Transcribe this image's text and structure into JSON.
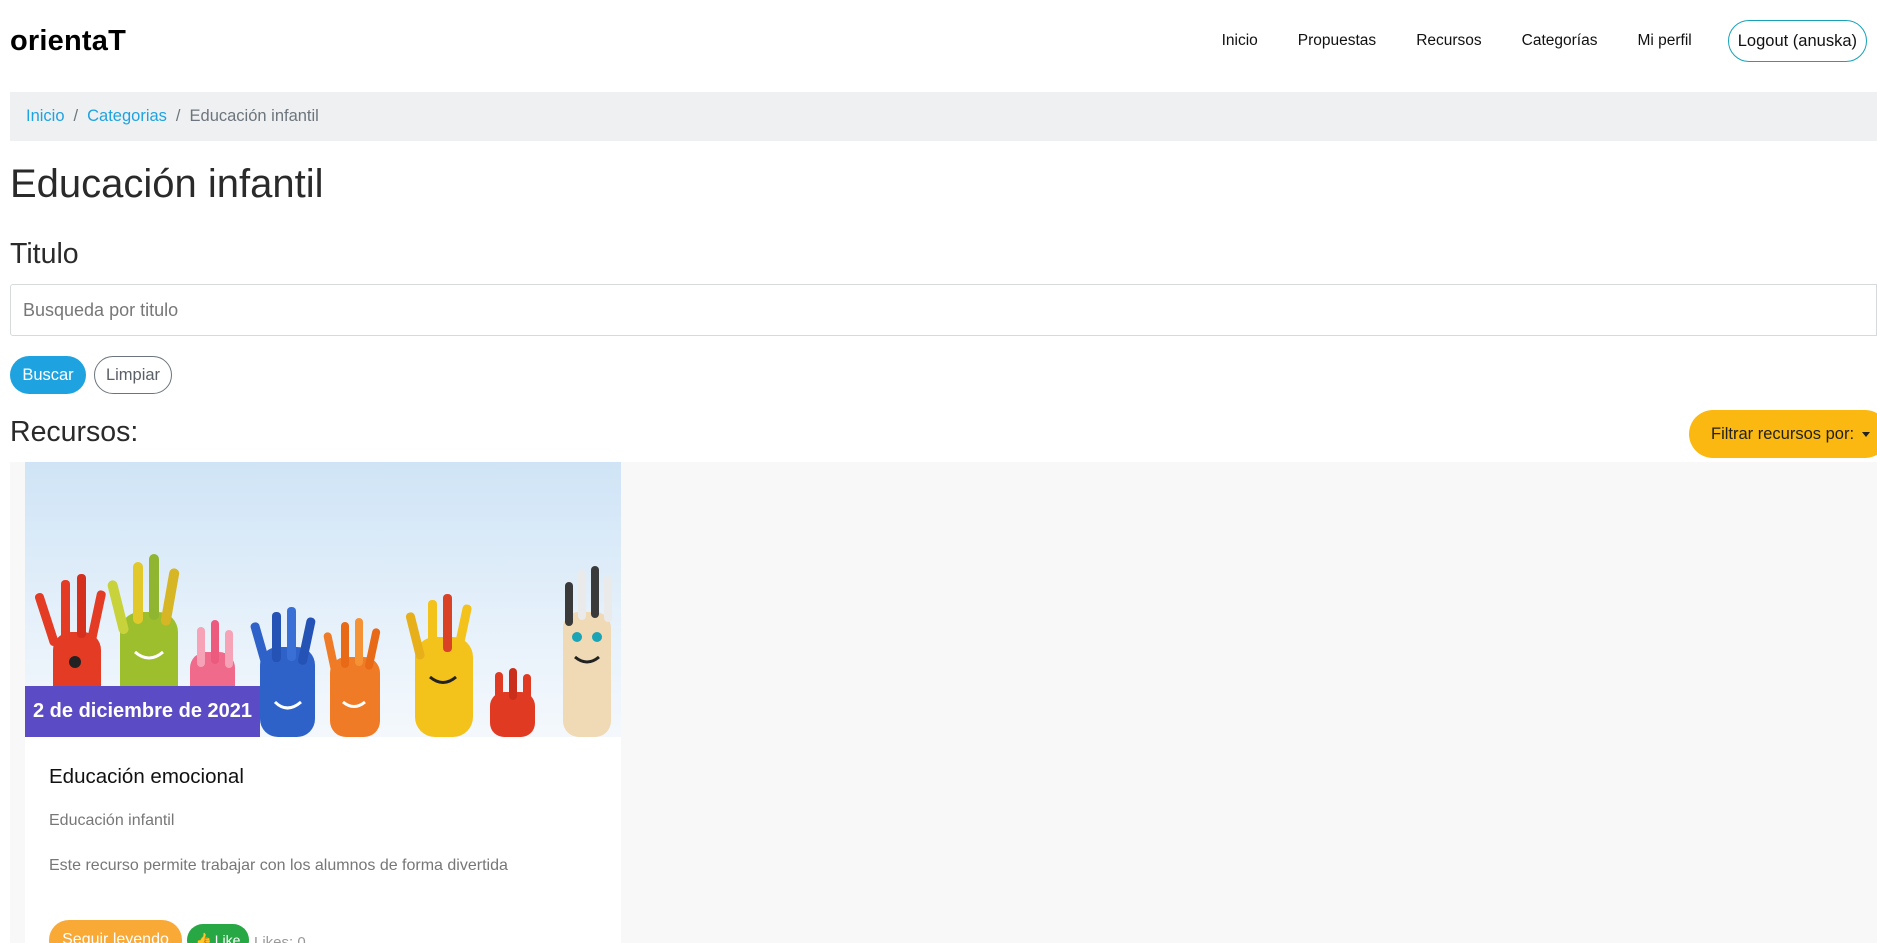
{
  "header": {
    "brand": "orientaT",
    "nav": [
      {
        "label": "Inicio"
      },
      {
        "label": "Propuestas"
      },
      {
        "label": "Recursos"
      },
      {
        "label": "Categorías"
      },
      {
        "label": "Mi perfil"
      }
    ],
    "logout_label": "Logout (anuska)"
  },
  "breadcrumb": {
    "items": [
      "Inicio",
      "Categorias"
    ],
    "separator": "/",
    "active": "Educación infantil"
  },
  "page": {
    "title": "Educación infantil",
    "search_label": "Titulo",
    "search_placeholder": "Busqueda por titulo",
    "search_button": "Buscar",
    "clear_button": "Limpiar",
    "section_title": "Recursos:",
    "filter_button": "Filtrar recursos por:"
  },
  "resources": [
    {
      "date": "2 de diciembre de 2021",
      "title": "Educación emocional",
      "category": "Educación infantil",
      "description": "Este recurso permite trabajar con los alumnos de forma divertida",
      "read_more": "Seguir leyendo",
      "like_label": "Like",
      "likes_text": "Likes: 0",
      "image_icon": "painted-hands-image"
    }
  ],
  "colors": {
    "primary": "#1fa3e0",
    "warning": "#fbb811",
    "date_badge": "#5b4bc4",
    "read_more": "#f8a936",
    "like": "#28a745",
    "logout_border": "#17a2b8"
  }
}
